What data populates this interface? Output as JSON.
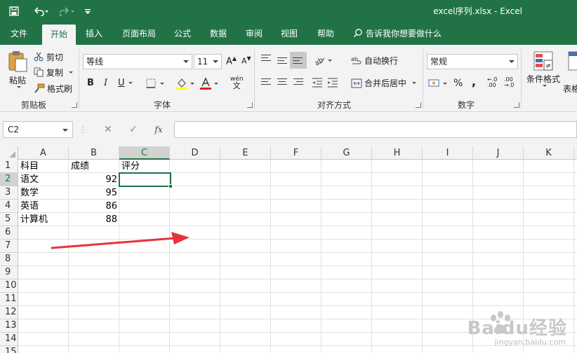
{
  "window": {
    "title": "excel序列.xlsx  -  Excel"
  },
  "menu": {
    "tabs": [
      "文件",
      "开始",
      "插入",
      "页面布局",
      "公式",
      "数据",
      "审阅",
      "视图",
      "帮助"
    ],
    "active": "开始",
    "tell_me": "告诉我你想要做什么"
  },
  "ribbon": {
    "clipboard": {
      "label": "剪贴板",
      "paste": "粘贴",
      "cut": "剪切",
      "copy": "复制",
      "format_painter": "格式刷"
    },
    "font": {
      "label": "字体",
      "font_name": "等线",
      "font_size": "11",
      "bold": "B",
      "italic": "I",
      "underline": "U",
      "wen": "wén"
    },
    "alignment": {
      "label": "对齐方式",
      "wrap_text": "自动换行",
      "merge_center": "合并后居中"
    },
    "number": {
      "label": "数字",
      "format": "常规",
      "percent": "%",
      "comma": ","
    },
    "styles": {
      "conditional_format": "条件格式",
      "table_format_partial": "表格"
    }
  },
  "formula_bar": {
    "name_box": "C2",
    "cancel": "✕",
    "enter": "✓",
    "fx": "fx",
    "content": ""
  },
  "sheet": {
    "columns": [
      "A",
      "B",
      "C",
      "D",
      "E",
      "F",
      "G",
      "H",
      "I",
      "J",
      "K"
    ],
    "selected_column": "C",
    "rows": [
      "1",
      "2",
      "3",
      "4",
      "5",
      "6",
      "7",
      "8",
      "9",
      "10",
      "11",
      "12",
      "13",
      "14",
      "15"
    ],
    "selected_row": "2",
    "cells": {
      "A1": "科目",
      "B1": "成绩",
      "C1": "评分",
      "A2": "语文",
      "B2": "92",
      "A3": "数学",
      "B3": "95",
      "A4": "英语",
      "B4": "86",
      "A5": "计算机",
      "B5": "88"
    },
    "active_cell": "C2"
  },
  "annotation": {
    "arrow_color": "#e8333a"
  },
  "watermark": {
    "brand": "Baidu经验",
    "url": "jingyan.baidu.com"
  },
  "colors": {
    "excel_green": "#217346"
  }
}
